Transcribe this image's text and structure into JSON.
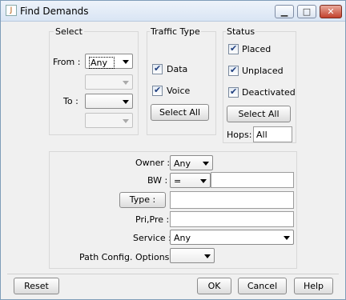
{
  "window": {
    "title": "Find Demands",
    "icon_glyph": "J",
    "controls": {
      "minimize": "▁",
      "maximize": "□",
      "close": "✕"
    }
  },
  "select": {
    "heading": "Select",
    "from_label": "From :",
    "from_value": "Any",
    "from_sub_value": "",
    "to_label": "To :",
    "to_value": "",
    "to_sub_value": ""
  },
  "traffic": {
    "heading": "Traffic Type",
    "data_label": "Data",
    "data_checked": true,
    "voice_label": "Voice",
    "voice_checked": true,
    "select_all": "Select All"
  },
  "status": {
    "heading": "Status",
    "placed_label": "Placed",
    "placed_checked": true,
    "unplaced_label": "Unplaced",
    "unplaced_checked": true,
    "deactivated_label": "Deactivated",
    "deactivated_checked": true,
    "select_all": "Select All",
    "hops_label": "Hops:",
    "hops_value": "All"
  },
  "filters": {
    "owner_label": "Owner :",
    "owner_value": "Any",
    "bw_label": "BW :",
    "bw_op": "=",
    "bw_value": "",
    "type_button": "Type :",
    "type_value": "",
    "pripre_label": "Pri,Pre :",
    "pripre_value": "",
    "service_label": "Service :",
    "service_value": "Any",
    "path_label": "Path Config. Options :",
    "path_value": ""
  },
  "footer": {
    "reset": "Reset",
    "ok": "OK",
    "cancel": "Cancel",
    "help": "Help"
  },
  "tick_glyph": "✔"
}
